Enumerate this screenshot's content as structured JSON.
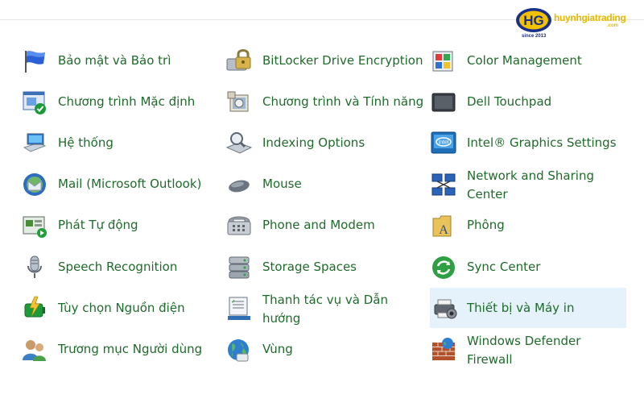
{
  "logo": {
    "brand": "huynhgiatrading",
    "suffix": ".com",
    "since": "since 2013",
    "brand_color": "#e6b800",
    "mark_color": "#1a2f8a"
  },
  "colors": {
    "link": "#1e6b2a",
    "selected_bg": "#e5f1fb"
  },
  "items": [
    {
      "label": "Bảo mật và Bảo trì",
      "icon": "security-flag-icon"
    },
    {
      "label": "Chương trình Mặc định",
      "icon": "default-programs-icon"
    },
    {
      "label": "Hệ thống",
      "icon": "system-icon"
    },
    {
      "label": "Mail (Microsoft Outlook)",
      "icon": "mail-icon"
    },
    {
      "label": "Phát Tự động",
      "icon": "autoplay-icon"
    },
    {
      "label": "Speech Recognition",
      "icon": "microphone-icon"
    },
    {
      "label": "Tùy chọn Nguồn điện",
      "icon": "power-options-icon"
    },
    {
      "label": "Trương mục Người dùng",
      "icon": "user-accounts-icon"
    },
    {
      "label": "BitLocker Drive Encryption",
      "icon": "bitlocker-icon"
    },
    {
      "label": "Chương trình và Tính năng",
      "icon": "programs-features-icon"
    },
    {
      "label": "Indexing Options",
      "icon": "indexing-icon"
    },
    {
      "label": "Mouse",
      "icon": "mouse-icon"
    },
    {
      "label": "Phone and Modem",
      "icon": "phone-modem-icon"
    },
    {
      "label": "Storage Spaces",
      "icon": "storage-spaces-icon"
    },
    {
      "label": "Thanh tác vụ và Dẫn hướng",
      "icon": "taskbar-icon"
    },
    {
      "label": "Vùng",
      "icon": "region-icon"
    },
    {
      "label": "Color Management",
      "icon": "color-management-icon"
    },
    {
      "label": "Dell Touchpad",
      "icon": "touchpad-icon"
    },
    {
      "label": "Intel® Graphics Settings",
      "icon": "intel-graphics-icon"
    },
    {
      "label": "Network and Sharing Center",
      "icon": "network-icon"
    },
    {
      "label": "Phông",
      "icon": "fonts-icon"
    },
    {
      "label": "Sync Center",
      "icon": "sync-icon"
    },
    {
      "label": "Thiết bị và Máy in",
      "icon": "devices-printers-icon",
      "selected": true
    },
    {
      "label": "Windows Defender Firewall",
      "icon": "firewall-icon"
    }
  ]
}
